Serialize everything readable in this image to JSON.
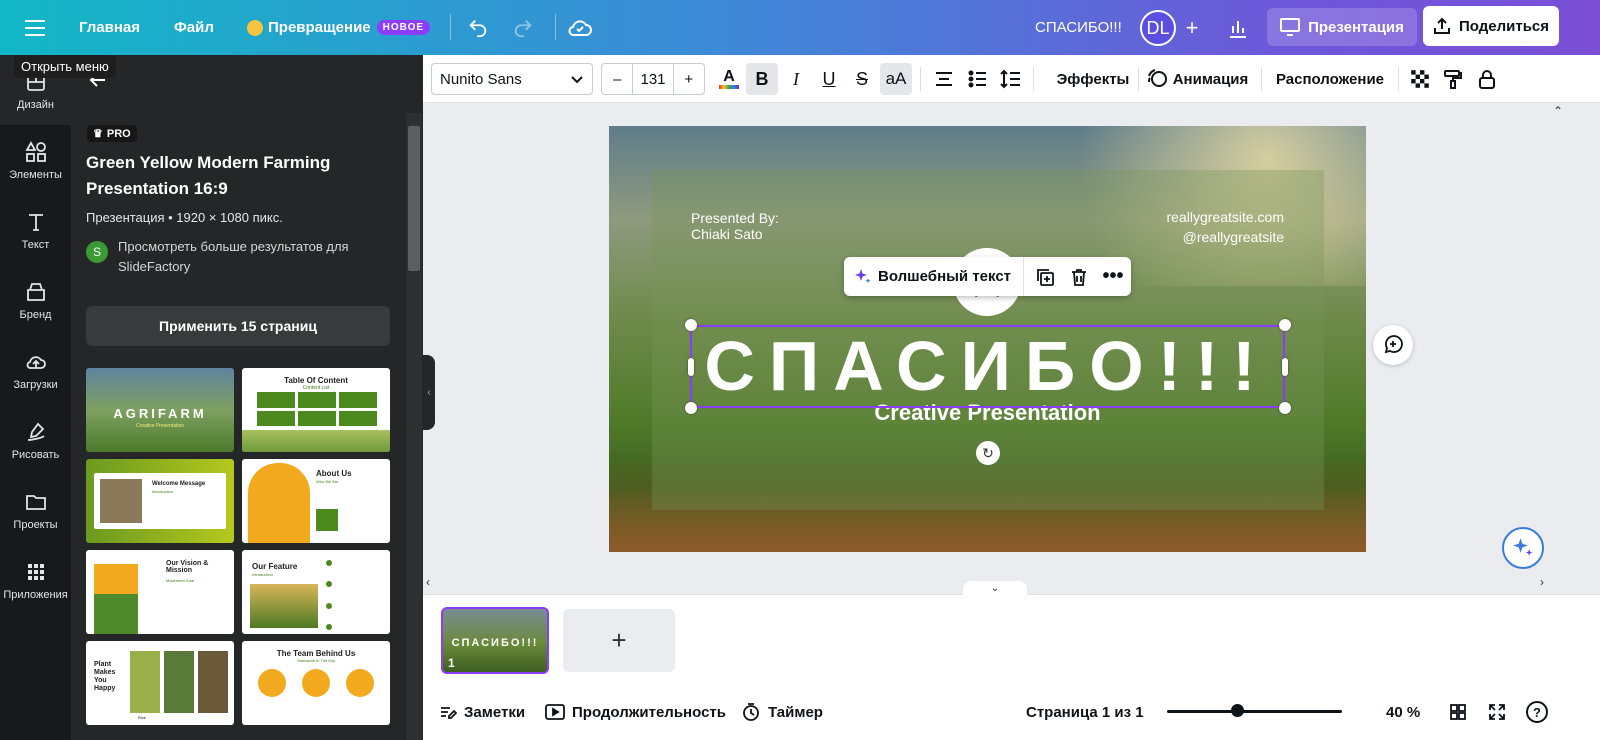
{
  "topbar": {
    "home": "Главная",
    "file": "Файл",
    "transform": "Превращение",
    "new_badge": "НОВОЕ",
    "doc_title": "СПАСИБО!!!",
    "avatar": "DL",
    "present": "Презентация",
    "share": "Поделиться",
    "tooltip": "Открыть меню"
  },
  "rail": [
    {
      "label": "Дизайн",
      "icon": "design-icon"
    },
    {
      "label": "Элементы",
      "icon": "elements-icon"
    },
    {
      "label": "Текст",
      "icon": "text-icon"
    },
    {
      "label": "Бренд",
      "icon": "brand-icon"
    },
    {
      "label": "Загрузки",
      "icon": "uploads-icon"
    },
    {
      "label": "Рисовать",
      "icon": "draw-icon"
    },
    {
      "label": "Проекты",
      "icon": "projects-icon"
    },
    {
      "label": "Приложения",
      "icon": "apps-icon"
    }
  ],
  "panel": {
    "pro": "PRO",
    "title": "Green Yellow Modern Farming Presentation 16:9",
    "meta": "Презентация • 1920 × 1080 пикс.",
    "author_line": "Просмотреть больше результатов для SlideFactory",
    "author_initial": "S",
    "apply": "Применить 15 страниц",
    "thumbs": [
      {
        "title": "AGRIFARM",
        "sub": "Creative Presentation"
      },
      {
        "title": "Table Of Content",
        "sub": "Content List"
      },
      {
        "title": "Welcome Message",
        "sub": "Introduction"
      },
      {
        "title": "About Us",
        "sub": "Who We Are"
      },
      {
        "title": "Our Vision & Mission",
        "sub": "Movement Goal"
      },
      {
        "title": "Our Feature",
        "sub": "Introduction"
      },
      {
        "title": "Plant Makes You Happy",
        "sub": "Rice"
      },
      {
        "title": "The Team Behind Us",
        "sub": "Teamwork In The Key"
      }
    ]
  },
  "toolbar": {
    "font": "Nunito Sans",
    "minus": "–",
    "size": "131",
    "plus": "+",
    "effects": "Эффекты",
    "animation": "Анимация",
    "position": "Расположение"
  },
  "slide": {
    "presented_by": "Presented By:",
    "presenter": "Chiaki Sato",
    "site": "reallygreatsite.com",
    "handle": "@reallygreatsite",
    "title": "СПАСИБО!!!",
    "subtitle": "Creative Presentation",
    "magic_text": "Волшебный текст"
  },
  "pages": {
    "thumb_title": "СПАСИБО!!!",
    "thumb_number": "1",
    "add": "+"
  },
  "bottombar": {
    "notes": "Заметки",
    "duration": "Продолжительность",
    "timer": "Таймер",
    "page_info": "Страница 1 из 1",
    "zoom": "40 %",
    "zoom_level": 0.4
  },
  "colors": {
    "accent": "#8b3dff",
    "panel_bg": "#252627",
    "rail_bg": "#18191b"
  }
}
